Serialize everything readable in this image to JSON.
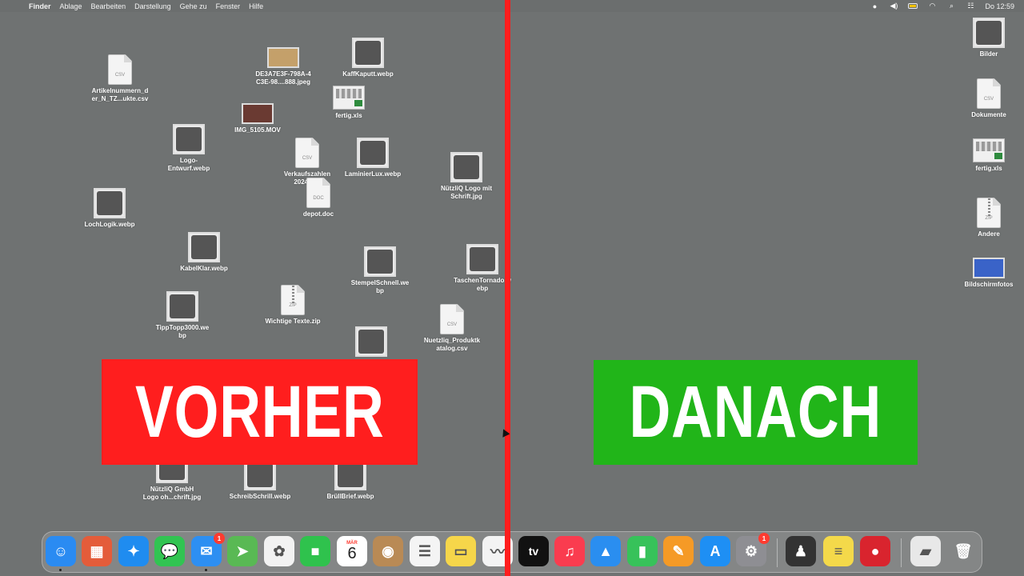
{
  "menubar": {
    "apple": "",
    "items": [
      "Finder",
      "Ablage",
      "Bearbeiten",
      "Darstellung",
      "Gehe zu",
      "Fenster",
      "Hilfe"
    ],
    "status_icons": [
      "screen-recording-icon",
      "volume-icon",
      "battery-icon",
      "wifi-icon",
      "search-icon",
      "control-center-icon"
    ],
    "clock": "Do 12:59"
  },
  "left_desktop": [
    {
      "label": "Artikelnummern_d\ner_N_TZ...ukte.csv",
      "icon": "csv-file-icon",
      "type": "doc",
      "ext": "CSV"
    },
    {
      "label": "DE3A7E3F-798A-4\nC3E-98....888.jpeg",
      "icon": "image-file-icon",
      "type": "wide",
      "color": "#c4a06a"
    },
    {
      "label": "KaffKaputt.webp",
      "icon": "coffee-machine-image-icon",
      "type": "photo"
    },
    {
      "label": "fertig.xls",
      "icon": "spreadsheet-file-icon",
      "type": "sheet"
    },
    {
      "label": "IMG_5105.MOV",
      "icon": "video-file-icon",
      "type": "wide",
      "color": "#6a3a32"
    },
    {
      "label": "Logo-\nEntwurf.webp",
      "icon": "logo-image-icon",
      "type": "photo"
    },
    {
      "label": "Verkaufszahlen\n2024.csv",
      "icon": "csv-file-icon",
      "type": "doc",
      "ext": "CSV"
    },
    {
      "label": "LaminierLux.webp",
      "icon": "laminator-image-icon",
      "type": "photo"
    },
    {
      "label": "NützliQ Logo mit\nSchrift.jpg",
      "icon": "logo-image-icon",
      "type": "photo"
    },
    {
      "label": "depot.doc",
      "icon": "word-file-icon",
      "type": "doc",
      "ext": "DOC"
    },
    {
      "label": "LochLogik.webp",
      "icon": "hole-punch-image-icon",
      "type": "photo"
    },
    {
      "label": "KabelKlar.webp",
      "icon": "cable-organizer-image-icon",
      "type": "photo"
    },
    {
      "label": "StempelSchnell.we\nbp",
      "icon": "stamp-image-icon",
      "type": "photo"
    },
    {
      "label": "TaschenTornado.w\nebp",
      "icon": "vacuum-image-icon",
      "type": "photo"
    },
    {
      "label": "TippTopp3000.we\nbp",
      "icon": "calculator-image-icon",
      "type": "photo"
    },
    {
      "label": "Wichtige Texte.zip",
      "icon": "zip-file-icon",
      "type": "zip",
      "ext": "ZIP"
    },
    {
      "label": "Nuetzliq_Produktk\natalog.csv",
      "icon": "csv-file-icon",
      "type": "doc",
      "ext": "CSV"
    },
    {
      "label": "",
      "icon": "logo-image-icon",
      "type": "photo"
    },
    {
      "label": "NützliQ GmbH\nLogo oh...chrift.jpg",
      "icon": "logo-image-icon",
      "type": "photo"
    },
    {
      "label": "SchreibSchrill.webp",
      "icon": "pen-image-icon",
      "type": "photo"
    },
    {
      "label": "BrüllBrief.webp",
      "icon": "letter-image-icon",
      "type": "photo"
    }
  ],
  "right_desktop": [
    {
      "label": "Bilder",
      "icon": "stack-images-icon",
      "type": "photo"
    },
    {
      "label": "Dokumente",
      "icon": "stack-documents-icon",
      "type": "doc",
      "ext": "CSV"
    },
    {
      "label": "fertig.xls",
      "icon": "spreadsheet-file-icon",
      "type": "sheet"
    },
    {
      "label": "Andere",
      "icon": "stack-other-icon",
      "type": "zip",
      "ext": "ZIP"
    },
    {
      "label": "Bildschirmfotos",
      "icon": "stack-screenshots-icon",
      "type": "wide",
      "color": "#3a63c8"
    }
  ],
  "banners": {
    "before": {
      "text": "VORHER",
      "color": "#ff1e1e"
    },
    "after": {
      "text": "DANACH",
      "color": "#21b519"
    }
  },
  "dock": [
    {
      "name": "finder",
      "icon": "finder-icon",
      "glyph": "☺",
      "bg": "#2a8bf2",
      "running": true
    },
    {
      "name": "launchpad",
      "icon": "launchpad-icon",
      "glyph": "▦",
      "bg": "#e45c3a"
    },
    {
      "name": "safari",
      "icon": "safari-icon",
      "glyph": "✦",
      "bg": "#1f8cf0"
    },
    {
      "name": "messages",
      "icon": "messages-icon",
      "glyph": "💬",
      "bg": "#31c452"
    },
    {
      "name": "mail",
      "icon": "mail-icon",
      "glyph": "✉",
      "bg": "#2d8ff2",
      "badge": "1",
      "running": true
    },
    {
      "name": "maps",
      "icon": "maps-icon",
      "glyph": "➤",
      "bg": "#59b954"
    },
    {
      "name": "photos",
      "icon": "photos-icon",
      "glyph": "✿",
      "bg": "#f2f2f2"
    },
    {
      "name": "facetime",
      "icon": "facetime-icon",
      "glyph": "■",
      "bg": "#2fc24d"
    },
    {
      "name": "calendar",
      "icon": "calendar-icon",
      "month": "MÄR",
      "day": "6"
    },
    {
      "name": "contacts",
      "icon": "contacts-icon",
      "glyph": "◉",
      "bg": "#b98a55"
    },
    {
      "name": "reminders",
      "icon": "reminders-icon",
      "glyph": "☰",
      "bg": "#f4f4f4"
    },
    {
      "name": "notes",
      "icon": "notes-icon",
      "glyph": "▭",
      "bg": "#f6d64a"
    },
    {
      "name": "freeform",
      "icon": "freeform-icon",
      "glyph": "〰",
      "bg": "#f3f3f3"
    },
    {
      "name": "tv",
      "icon": "apple-tv-icon",
      "glyph": "tv",
      "bg": "#111111"
    },
    {
      "name": "music",
      "icon": "music-icon",
      "glyph": "♫",
      "bg": "#fa3c4f"
    },
    {
      "name": "keynote",
      "icon": "keynote-icon",
      "glyph": "▲",
      "bg": "#2a8ef0"
    },
    {
      "name": "numbers",
      "icon": "numbers-icon",
      "glyph": "▮",
      "bg": "#37c25a"
    },
    {
      "name": "pages",
      "icon": "pages-icon",
      "glyph": "✎",
      "bg": "#f59a26"
    },
    {
      "name": "appstore",
      "icon": "app-store-icon",
      "glyph": "A",
      "bg": "#1e8ff4"
    },
    {
      "name": "settings",
      "icon": "system-settings-icon",
      "glyph": "⚙",
      "bg": "#8e8e93",
      "badge": "1"
    },
    {
      "name": "chess",
      "icon": "chess-app-icon",
      "glyph": "♟",
      "bg": "#333333"
    },
    {
      "name": "stickies",
      "icon": "stickies-icon",
      "glyph": "≡",
      "bg": "#f4d94a"
    },
    {
      "name": "photobooth",
      "icon": "photo-booth-icon",
      "glyph": "●",
      "bg": "#d9242e"
    },
    {
      "name": "downloads",
      "icon": "downloads-stack-icon",
      "glyph": "▰",
      "bg": "#e8e8e8"
    },
    {
      "name": "trash",
      "icon": "trash-icon",
      "glyph": "🗑",
      "bg": "transparent"
    }
  ]
}
